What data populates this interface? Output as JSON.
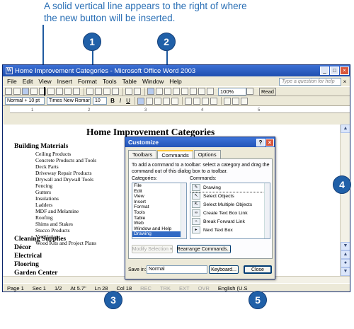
{
  "caption": "A solid vertical line appears to the right of where the new button will be inserted.",
  "callouts": [
    "1",
    "2",
    "3",
    "4",
    "5"
  ],
  "window": {
    "title": "Home Improvement Categories - Microsoft Office Word 2003",
    "icon_letter": "W",
    "controls": [
      "_",
      "□",
      "×"
    ]
  },
  "menubar": {
    "items": [
      "File",
      "Edit",
      "View",
      "Insert",
      "Format",
      "Tools",
      "Table",
      "Window",
      "Help"
    ],
    "help_placeholder": "Type a question for help",
    "close_glyph": "×"
  },
  "toolbar": {
    "zoom": "100%",
    "read_label": "Read"
  },
  "format_bar": {
    "style": "Normal + 10 pt",
    "font": "Times New Roman",
    "size": "10",
    "bold": "B",
    "italic": "I",
    "underline": "U"
  },
  "ruler": {
    "marks": [
      "1",
      "2",
      "3",
      "4",
      "5"
    ]
  },
  "document": {
    "title": "Home Improvement Categories",
    "sections": [
      {
        "heading": "Building Materials",
        "items": [
          "Ceiling Products",
          "Concrete Products and Tools",
          "Deck Parts",
          "Driveway Repair Products",
          "Drywall and Drywall Tools",
          "Fencing",
          "Gutters",
          "Insulations",
          "Ladders",
          "MDF and Melamine",
          "Roofing",
          "Shims and Stakes",
          "Stucco Products",
          "Ventilation",
          "Wood Kits and Project Plans"
        ]
      }
    ],
    "more_headings": [
      "Cleaning Supplies",
      "Décor",
      "Electrical",
      "Flooring",
      "Garden Center"
    ]
  },
  "statusbar": {
    "page": "Page 1",
    "sec": "Sec 1",
    "pages": "1/2",
    "at": "At 5.7\"",
    "ln": "Ln 28",
    "col": "Col 18",
    "rec": "REC",
    "trk": "TRK",
    "ext": "EXT",
    "ovr": "OVR",
    "lang": "English (U.S"
  },
  "dialog": {
    "title": "Customize",
    "help_glyph": "?",
    "close_glyph": "×",
    "tabs": [
      "Toolbars",
      "Commands",
      "Options"
    ],
    "active_tab": "Commands",
    "instructions": "To add a command to a toolbar: select a category and drag the command out of this dialog box to a toolbar.",
    "categories_label": "Categories:",
    "commands_label": "Commands:",
    "categories": [
      "File",
      "Edit",
      "View",
      "Insert",
      "Format",
      "Tools",
      "Table",
      "Web",
      "Window and Help",
      "Drawing"
    ],
    "selected_category": "Drawing",
    "commands": [
      "Drawing",
      "Select Objects",
      "Select Multiple Objects",
      "Create Text Box Link",
      "Break Forward Link",
      "Next Text Box"
    ],
    "modify_selection": "Modify Selection ▾",
    "rearrange": "Rearrange Commands...",
    "save_in_label": "Save in:",
    "save_in_value": "Normal",
    "keyboard": "Keyboard...",
    "close": "Close"
  }
}
